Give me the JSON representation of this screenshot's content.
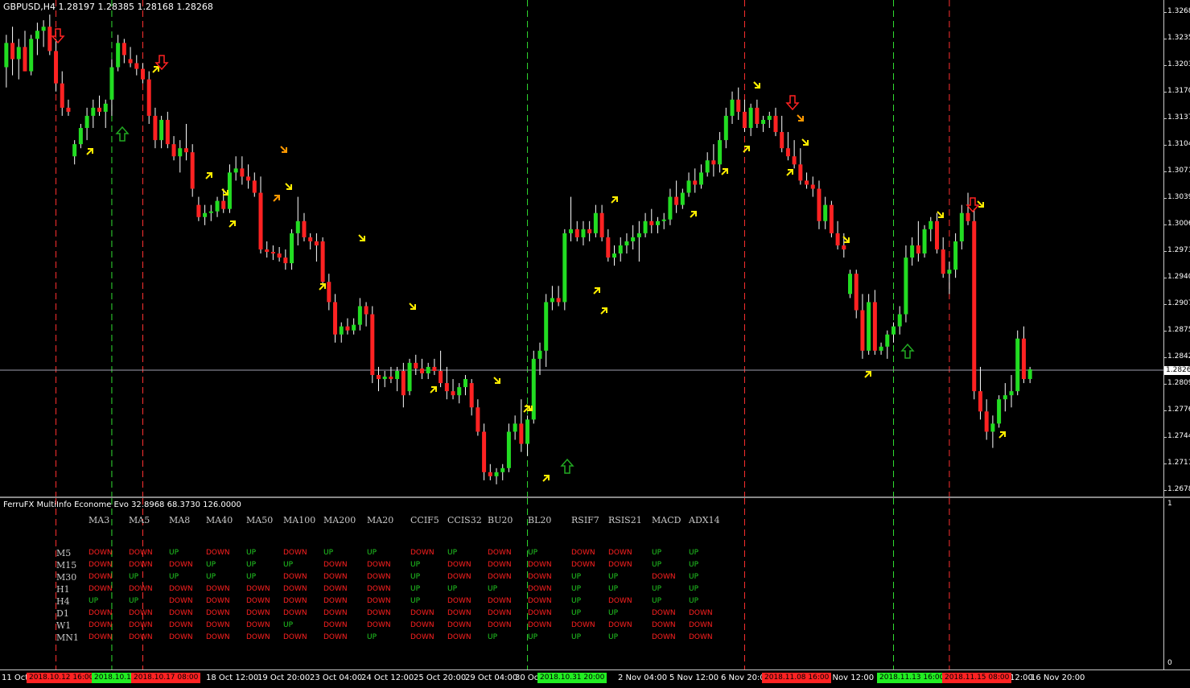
{
  "symbol_info": "GBPUSD,H4  1.28197 1.28385 1.28168 1.28268",
  "current_price": "1.2826",
  "price_labels": [
    "1.3268",
    "1.3235",
    "1.3203",
    "1.3170",
    "1.3137",
    "1.3104",
    "1.3071",
    "1.3039",
    "1.3006",
    "1.2973",
    "1.2940",
    "1.2907",
    "1.2875",
    "1.2842",
    "1.2809",
    "1.2776",
    "1.2744",
    "1.2711",
    "1.2678"
  ],
  "indicator": {
    "title": "FerruFX MultiInfo Econome Evo 32.8968 68.3730 126.0000",
    "axis_top": "1",
    "axis_bottom": "0",
    "columns": [
      "MA3",
      "MA5",
      "MA8",
      "MA40",
      "MA50",
      "MA100",
      "MA200",
      "MA20",
      "CCIF5",
      "CCIS32",
      "BU20",
      "BL20",
      "RSIF7",
      "RSIS21",
      "MACD",
      "ADX14"
    ],
    "rows": [
      {
        "tf": "M5",
        "values": [
          "DOWN",
          "DOWN",
          "UP",
          "DOWN",
          "UP",
          "DOWN",
          "UP",
          "UP",
          "DOWN",
          "UP",
          "DOWN",
          "UP",
          "DOWN",
          "DOWN",
          "UP",
          "UP"
        ]
      },
      {
        "tf": "M15",
        "values": [
          "DOWN",
          "DOWN",
          "DOWN",
          "UP",
          "UP",
          "UP",
          "DOWN",
          "DOWN",
          "UP",
          "DOWN",
          "DOWN",
          "DOWN",
          "DOWN",
          "DOWN",
          "UP",
          "UP"
        ]
      },
      {
        "tf": "M30",
        "values": [
          "DOWN",
          "UP",
          "UP",
          "UP",
          "UP",
          "DOWN",
          "DOWN",
          "DOWN",
          "UP",
          "DOWN",
          "DOWN",
          "DOWN",
          "UP",
          "UP",
          "DOWN",
          "UP"
        ]
      },
      {
        "tf": "H1",
        "values": [
          "DOWN",
          "DOWN",
          "DOWN",
          "DOWN",
          "DOWN",
          "DOWN",
          "DOWN",
          "DOWN",
          "UP",
          "UP",
          "UP",
          "DOWN",
          "UP",
          "UP",
          "UP",
          "UP"
        ]
      },
      {
        "tf": "H4",
        "values": [
          "UP",
          "UP",
          "DOWN",
          "DOWN",
          "DOWN",
          "DOWN",
          "DOWN",
          "DOWN",
          "UP",
          "DOWN",
          "DOWN",
          "DOWN",
          "UP",
          "DOWN",
          "UP",
          "UP"
        ]
      },
      {
        "tf": "D1",
        "values": [
          "DOWN",
          "DOWN",
          "DOWN",
          "DOWN",
          "DOWN",
          "DOWN",
          "DOWN",
          "DOWN",
          "DOWN",
          "DOWN",
          "DOWN",
          "DOWN",
          "UP",
          "UP",
          "DOWN",
          "DOWN"
        ]
      },
      {
        "tf": "W1",
        "values": [
          "DOWN",
          "DOWN",
          "DOWN",
          "DOWN",
          "DOWN",
          "UP",
          "DOWN",
          "DOWN",
          "DOWN",
          "DOWN",
          "DOWN",
          "DOWN",
          "DOWN",
          "DOWN",
          "DOWN",
          "DOWN"
        ]
      },
      {
        "tf": "MN1",
        "values": [
          "DOWN",
          "DOWN",
          "DOWN",
          "DOWN",
          "DOWN",
          "DOWN",
          "DOWN",
          "UP",
          "DOWN",
          "DOWN",
          "UP",
          "UP",
          "UP",
          "UP",
          "DOWN",
          "DOWN"
        ]
      }
    ]
  },
  "time_labels": [
    "11 Oct",
    "18 Oct 12:00",
    "19 Oct 20:00",
    "23 Oct 04:00",
    "24 Oct 12:00",
    "25 Oct 20:00",
    "29 Oct 04:00",
    "30 Oc",
    "2 Nov 04:00",
    "5 Nov 12:00",
    "6 Nov 20:00",
    "9 Nov 12:00",
    "12:00",
    "16 Nov 20:00"
  ],
  "time_badges": [
    {
      "text": "2018.10.12 16:00",
      "color": "#ff2222"
    },
    {
      "text": "2018.10.16",
      "color": "#22ee22"
    },
    {
      "text": "2018.10.17 08:00",
      "color": "#ff2222"
    },
    {
      "text": "2018.10.31 20:00",
      "color": "#22ee22"
    },
    {
      "text": "2018.11.08 16:00",
      "color": "#ff2222"
    },
    {
      "text": "2018.11.13 16:00",
      "color": "#22ee22"
    },
    {
      "text": "2018.11.15 08:00",
      "color": "#ff2222"
    }
  ],
  "colors": {
    "bull": "#22dd22",
    "bear": "#ff2222",
    "up_text": "#22cc22",
    "down_text": "#ff2020",
    "vline_red": "#ff3030",
    "vline_green": "#30dd30",
    "arrow_yellow": "#ffee00",
    "arrow_orange": "#ff9900"
  },
  "candles": [
    [
      1.32,
      1.324,
      1.3175,
      1.323
    ],
    [
      1.323,
      1.325,
      1.319,
      1.321
    ],
    [
      1.321,
      1.3235,
      1.3185,
      1.3225
    ],
    [
      1.3225,
      1.3245,
      1.3195,
      1.3195
    ],
    [
      1.3195,
      1.324,
      1.319,
      1.3235
    ],
    [
      1.3235,
      1.3255,
      1.3215,
      1.3245
    ],
    [
      1.3245,
      1.3258,
      1.3225,
      1.325
    ],
    [
      1.325,
      1.3265,
      1.3215,
      1.322
    ],
    [
      1.322,
      1.3235,
      1.317,
      1.318
    ],
    [
      1.318,
      1.3195,
      1.314,
      1.315
    ],
    [
      1.315,
      1.316,
      1.314,
      1.3145
    ],
    [
      1.309,
      1.311,
      1.308,
      1.3105
    ],
    [
      1.3105,
      1.313,
      1.31,
      1.3125
    ],
    [
      1.3125,
      1.315,
      1.311,
      1.314
    ],
    [
      1.314,
      1.316,
      1.3125,
      1.315
    ],
    [
      1.315,
      1.3165,
      1.314,
      1.3145
    ],
    [
      1.3145,
      1.316,
      1.3125,
      1.3155
    ],
    [
      1.316,
      1.321,
      1.314,
      1.32
    ],
    [
      1.32,
      1.324,
      1.3195,
      1.323
    ],
    [
      1.323,
      1.3235,
      1.3205,
      1.3215
    ],
    [
      1.321,
      1.3225,
      1.32,
      1.3205
    ],
    [
      1.3205,
      1.3215,
      1.319,
      1.3198
    ],
    [
      1.3198,
      1.3205,
      1.318,
      1.3185
    ],
    [
      1.3185,
      1.3195,
      1.313,
      1.314
    ],
    [
      1.314,
      1.315,
      1.31,
      1.311
    ],
    [
      1.311,
      1.314,
      1.31,
      1.3135
    ],
    [
      1.3135,
      1.3145,
      1.31,
      1.3105
    ],
    [
      1.3105,
      1.3115,
      1.3085,
      1.309
    ],
    [
      1.309,
      1.311,
      1.307,
      1.31
    ],
    [
      1.31,
      1.313,
      1.3085,
      1.3095
    ],
    [
      1.3095,
      1.3105,
      1.304,
      1.305
    ],
    [
      1.303,
      1.304,
      1.301,
      1.3015
    ],
    [
      1.3015,
      1.303,
      1.3005,
      1.302
    ],
    [
      1.302,
      1.303,
      1.301,
      1.3022
    ],
    [
      1.3022,
      1.304,
      1.3015,
      1.3035
    ],
    [
      1.3035,
      1.305,
      1.302,
      1.3025
    ],
    [
      1.3025,
      1.308,
      1.302,
      1.307
    ],
    [
      1.307,
      1.309,
      1.306,
      1.3075
    ],
    [
      1.3075,
      1.309,
      1.3055,
      1.3065
    ],
    [
      1.3065,
      1.308,
      1.305,
      1.306
    ],
    [
      1.306,
      1.307,
      1.304,
      1.3045
    ],
    [
      1.3045,
      1.3065,
      1.297,
      1.2975
    ],
    [
      1.2975,
      1.2985,
      1.2965,
      1.2972
    ],
    [
      1.2972,
      1.298,
      1.2962,
      1.297
    ],
    [
      1.297,
      1.2978,
      1.296,
      1.2965
    ],
    [
      1.2965,
      1.2975,
      1.295,
      1.2958
    ],
    [
      1.2958,
      1.3,
      1.295,
      1.2995
    ],
    [
      1.2995,
      1.304,
      1.298,
      1.301
    ],
    [
      1.301,
      1.302,
      1.2985,
      1.299
    ],
    [
      1.299,
      1.2995,
      1.2975,
      1.2985
    ],
    [
      1.2985,
      1.2995,
      1.296,
      1.298
    ],
    [
      1.2985,
      1.299,
      1.293,
      1.2935
    ],
    [
      1.2935,
      1.2945,
      1.29,
      1.291
    ],
    [
      1.291,
      1.292,
      1.286,
      1.287
    ],
    [
      1.287,
      1.2885,
      1.286,
      1.288
    ],
    [
      1.288,
      1.289,
      1.287,
      1.2875
    ],
    [
      1.2875,
      1.289,
      1.287,
      1.2882
    ],
    [
      1.2882,
      1.2915,
      1.2875,
      1.2905
    ],
    [
      1.2905,
      1.291,
      1.288,
      1.2895
    ],
    [
      1.2895,
      1.2905,
      1.281,
      1.282
    ],
    [
      1.282,
      1.283,
      1.28,
      1.2815
    ],
    [
      1.2815,
      1.2825,
      1.2805,
      1.2818
    ],
    [
      1.2818,
      1.283,
      1.281,
      1.2815
    ],
    [
      1.2815,
      1.283,
      1.28,
      1.2825
    ],
    [
      1.2825,
      1.2835,
      1.278,
      1.2795
    ],
    [
      1.28,
      1.284,
      1.2795,
      1.2835
    ],
    [
      1.2835,
      1.2845,
      1.282,
      1.2828
    ],
    [
      1.2828,
      1.284,
      1.2815,
      1.2822
    ],
    [
      1.2822,
      1.2835,
      1.2815,
      1.283
    ],
    [
      1.283,
      1.284,
      1.282,
      1.2825
    ],
    [
      1.2825,
      1.285,
      1.2805,
      1.281
    ],
    [
      1.281,
      1.283,
      1.279,
      1.28
    ],
    [
      1.28,
      1.2815,
      1.279,
      1.2795
    ],
    [
      1.2795,
      1.281,
      1.2785,
      1.2805
    ],
    [
      1.2805,
      1.282,
      1.2795,
      1.2815
    ],
    [
      1.281,
      1.2815,
      1.277,
      1.278
    ],
    [
      1.278,
      1.279,
      1.2745,
      1.275
    ],
    [
      1.275,
      1.276,
      1.269,
      1.27
    ],
    [
      1.27,
      1.271,
      1.269,
      1.2695
    ],
    [
      1.2695,
      1.2705,
      1.2685,
      1.27
    ],
    [
      1.27,
      1.271,
      1.269,
      1.2705
    ],
    [
      1.2705,
      1.276,
      1.27,
      1.275
    ],
    [
      1.275,
      1.277,
      1.274,
      1.276
    ],
    [
      1.276,
      1.279,
      1.2725,
      1.2735
    ],
    [
      1.2735,
      1.277,
      1.272,
      1.2765
    ],
    [
      1.2765,
      1.285,
      1.276,
      1.284
    ],
    [
      1.284,
      1.286,
      1.282,
      1.285
    ],
    [
      1.285,
      1.292,
      1.283,
      1.291
    ],
    [
      1.291,
      1.293,
      1.29,
      1.2915
    ],
    [
      1.2915,
      1.293,
      1.2905,
      1.291
    ],
    [
      1.291,
      1.3,
      1.29,
      1.2995
    ],
    [
      1.2995,
      1.304,
      1.2985,
      1.3
    ],
    [
      1.3,
      1.301,
      1.2985,
      1.299
    ],
    [
      1.299,
      1.301,
      1.298,
      1.3
    ],
    [
      1.3,
      1.301,
      1.2985,
      1.2995
    ],
    [
      1.2995,
      1.303,
      1.299,
      1.302
    ],
    [
      1.302,
      1.303,
      1.2985,
      1.299
    ],
    [
      1.299,
      1.3,
      1.296,
      1.2965
    ],
    [
      1.2965,
      1.298,
      1.2955,
      1.297
    ],
    [
      1.297,
      1.299,
      1.296,
      1.298
    ],
    [
      1.298,
      1.2995,
      1.297,
      1.2985
    ],
    [
      1.2985,
      1.3005,
      1.2975,
      1.299
    ],
    [
      1.299,
      1.301,
      1.296,
      1.2995
    ],
    [
      1.2995,
      1.302,
      1.299,
      1.301
    ],
    [
      1.301,
      1.3025,
      1.2995,
      1.3005
    ],
    [
      1.3005,
      1.3015,
      1.2995,
      1.301
    ],
    [
      1.301,
      1.302,
      1.3,
      1.3012
    ],
    [
      1.3012,
      1.305,
      1.3005,
      1.304
    ],
    [
      1.304,
      1.306,
      1.302,
      1.303
    ],
    [
      1.303,
      1.305,
      1.3025,
      1.3045
    ],
    [
      1.3045,
      1.307,
      1.304,
      1.306
    ],
    [
      1.306,
      1.3075,
      1.3045,
      1.3055
    ],
    [
      1.3055,
      1.308,
      1.305,
      1.307
    ],
    [
      1.307,
      1.3095,
      1.3065,
      1.3085
    ],
    [
      1.3085,
      1.3105,
      1.3065,
      1.308
    ],
    [
      1.308,
      1.312,
      1.307,
      1.311
    ],
    [
      1.311,
      1.315,
      1.31,
      1.314
    ],
    [
      1.314,
      1.317,
      1.313,
      1.316
    ],
    [
      1.316,
      1.3175,
      1.3135,
      1.3145
    ],
    [
      1.3145,
      1.316,
      1.312,
      1.3125
    ],
    [
      1.3125,
      1.3155,
      1.3115,
      1.315
    ],
    [
      1.315,
      1.316,
      1.3125,
      1.313
    ],
    [
      1.313,
      1.314,
      1.312,
      1.3135
    ],
    [
      1.3135,
      1.3145,
      1.3125,
      1.314
    ],
    [
      1.314,
      1.315,
      1.3115,
      1.312
    ],
    [
      1.312,
      1.314,
      1.3095,
      1.31
    ],
    [
      1.31,
      1.312,
      1.3085,
      1.309
    ],
    [
      1.309,
      1.311,
      1.3075,
      1.308
    ],
    [
      1.308,
      1.31,
      1.3055,
      1.306
    ],
    [
      1.306,
      1.307,
      1.305,
      1.3055
    ],
    [
      1.3055,
      1.3065,
      1.304,
      1.305
    ],
    [
      1.305,
      1.306,
      1.3,
      1.301
    ],
    [
      1.301,
      1.304,
      1.3,
      1.303
    ],
    [
      1.303,
      1.3035,
      1.299,
      1.2995
    ],
    [
      1.2995,
      1.301,
      1.2975,
      1.298
    ],
    [
      1.298,
      1.2995,
      1.2965,
      1.2975
    ],
    [
      1.292,
      1.295,
      1.2915,
      1.2945
    ],
    [
      1.2945,
      1.295,
      1.289,
      1.29
    ],
    [
      1.29,
      1.292,
      1.284,
      1.285
    ],
    [
      1.285,
      1.292,
      1.2845,
      1.291
    ],
    [
      1.291,
      1.2925,
      1.2845,
      1.285
    ],
    [
      1.285,
      1.286,
      1.2845,
      1.2855
    ],
    [
      1.2855,
      1.2875,
      1.284,
      1.287
    ],
    [
      1.287,
      1.2885,
      1.286,
      1.288
    ],
    [
      1.288,
      1.2905,
      1.287,
      1.2895
    ],
    [
      1.2895,
      1.298,
      1.2885,
      1.2965
    ],
    [
      1.2965,
      1.299,
      1.2955,
      1.298
    ],
    [
      1.298,
      1.301,
      1.296,
      1.297
    ],
    [
      1.297,
      1.3005,
      1.2965,
      1.3
    ],
    [
      1.3,
      1.3015,
      1.2985,
      1.301
    ],
    [
      1.301,
      1.302,
      1.297,
      1.2975
    ],
    [
      1.2975,
      1.299,
      1.294,
      1.2945
    ],
    [
      1.2945,
      1.296,
      1.292,
      1.295
    ],
    [
      1.295,
      1.2995,
      1.294,
      1.2985
    ],
    [
      1.2985,
      1.303,
      1.2975,
      1.302
    ],
    [
      1.302,
      1.3045,
      1.3005,
      1.301
    ],
    [
      1.301,
      1.3025,
      1.279,
      1.28
    ],
    [
      1.28,
      1.283,
      1.2765,
      1.2775
    ],
    [
      1.2775,
      1.279,
      1.274,
      1.275
    ],
    [
      1.275,
      1.277,
      1.273,
      1.276
    ],
    [
      1.276,
      1.2795,
      1.2755,
      1.279
    ],
    [
      1.279,
      1.281,
      1.2775,
      1.2795
    ],
    [
      1.2795,
      1.282,
      1.278,
      1.28
    ],
    [
      1.28,
      1.2875,
      1.2795,
      1.2865
    ],
    [
      1.2865,
      1.288,
      1.281,
      1.2815
    ],
    [
      1.2815,
      1.283,
      1.281,
      1.2827
    ]
  ],
  "price_range": [
    1.267,
    1.3283
  ],
  "vlines": [
    {
      "i": 8,
      "c": "red"
    },
    {
      "i": 17,
      "c": "green"
    },
    {
      "i": 22,
      "c": "red"
    },
    {
      "i": 84,
      "c": "green"
    },
    {
      "i": 119,
      "c": "red"
    },
    {
      "i": 143,
      "c": "green"
    },
    {
      "i": 152,
      "c": "red"
    }
  ]
}
